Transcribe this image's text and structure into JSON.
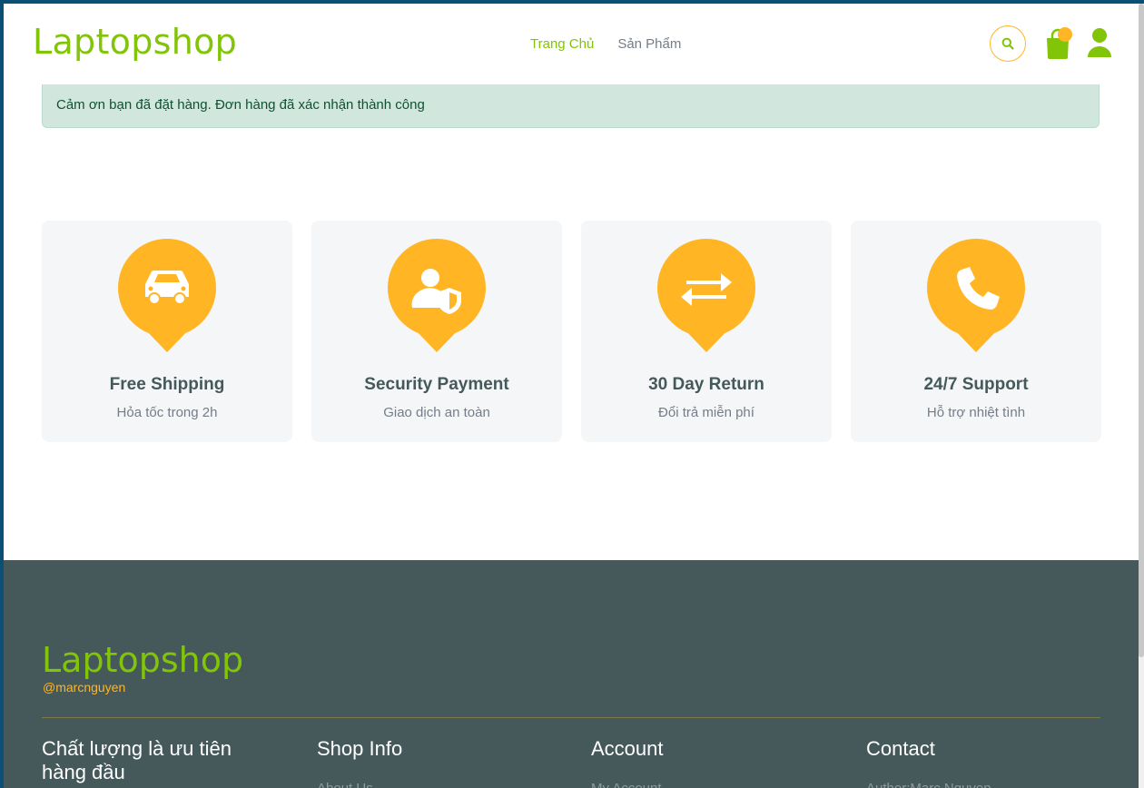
{
  "header": {
    "logo": "Laptopshop",
    "nav": [
      {
        "label": "Trang Chủ",
        "active": true
      },
      {
        "label": "Sản Phẩm",
        "active": false
      }
    ],
    "icons": [
      "search-icon",
      "shopping-bag-icon",
      "user-icon"
    ]
  },
  "alert": {
    "message": "Cảm ơn bạn đã đặt hàng. Đơn hàng đã xác nhận thành công"
  },
  "features": [
    {
      "icon": "car-icon",
      "title": "Free Shipping",
      "subtitle": "Hỏa tốc trong 2h"
    },
    {
      "icon": "user-shield-icon",
      "title": "Security Payment",
      "subtitle": "Giao dịch an toàn"
    },
    {
      "icon": "exchange-arrows-icon",
      "title": "30 Day Return",
      "subtitle": "Đổi trả miễn phí"
    },
    {
      "icon": "phone-icon",
      "title": "24/7 Support",
      "subtitle": "Hỗ trợ nhiệt tình"
    }
  ],
  "footer": {
    "logo": "Laptopshop",
    "handle": "@marcnguyen",
    "columns": [
      {
        "title": "Chất lượng là ưu tiên hàng đầu",
        "link": ""
      },
      {
        "title": "Shop Info",
        "link": "About Us"
      },
      {
        "title": "Account",
        "link": "My Account"
      },
      {
        "title": "Contact",
        "link": "Author:Marc Nguyen"
      }
    ]
  },
  "colors": {
    "brand_green": "#81c408",
    "accent_orange": "#ffb524",
    "footer_bg": "#45595b",
    "alert_bg": "#d1e7dd"
  }
}
